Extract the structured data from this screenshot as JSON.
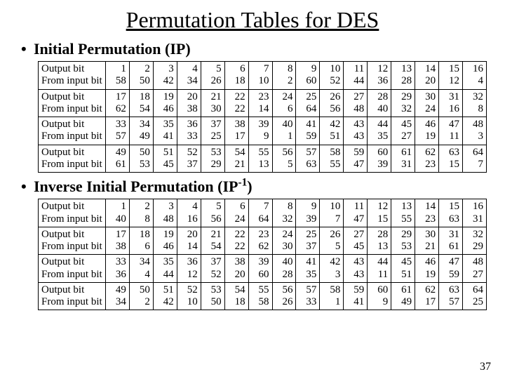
{
  "title": "Permutation Tables for DES",
  "page_number": "37",
  "sections": [
    {
      "heading_html": "Initial Permutation (IP)",
      "row_label_a": "Output bit",
      "row_label_b": "From input bit",
      "rows": [
        {
          "out": [
            1,
            2,
            3,
            4,
            5,
            6,
            7,
            8,
            9,
            10,
            11,
            12,
            13,
            14,
            15,
            16
          ],
          "from": [
            58,
            50,
            42,
            34,
            26,
            18,
            10,
            2,
            60,
            52,
            44,
            36,
            28,
            20,
            12,
            4
          ]
        },
        {
          "out": [
            17,
            18,
            19,
            20,
            21,
            22,
            23,
            24,
            25,
            26,
            27,
            28,
            29,
            30,
            31,
            32
          ],
          "from": [
            62,
            54,
            46,
            38,
            30,
            22,
            14,
            6,
            64,
            56,
            48,
            40,
            32,
            24,
            16,
            8
          ]
        },
        {
          "out": [
            33,
            34,
            35,
            36,
            37,
            38,
            39,
            40,
            41,
            42,
            43,
            44,
            45,
            46,
            47,
            48
          ],
          "from": [
            57,
            49,
            41,
            33,
            25,
            17,
            9,
            1,
            59,
            51,
            43,
            35,
            27,
            19,
            11,
            3
          ]
        },
        {
          "out": [
            49,
            50,
            51,
            52,
            53,
            54,
            55,
            56,
            57,
            58,
            59,
            60,
            61,
            62,
            63,
            64
          ],
          "from": [
            61,
            53,
            45,
            37,
            29,
            21,
            13,
            5,
            63,
            55,
            47,
            39,
            31,
            23,
            15,
            7
          ]
        }
      ]
    },
    {
      "heading_html": "Inverse Initial Permutation (IP<sup>-1</sup>)",
      "row_label_a": "Output bit",
      "row_label_b": "From input bit",
      "rows": [
        {
          "out": [
            1,
            2,
            3,
            4,
            5,
            6,
            7,
            8,
            9,
            10,
            11,
            12,
            13,
            14,
            15,
            16
          ],
          "from": [
            40,
            8,
            48,
            16,
            56,
            24,
            64,
            32,
            39,
            7,
            47,
            15,
            55,
            23,
            63,
            31
          ]
        },
        {
          "out": [
            17,
            18,
            19,
            20,
            21,
            22,
            23,
            24,
            25,
            26,
            27,
            28,
            29,
            30,
            31,
            32
          ],
          "from": [
            38,
            6,
            46,
            14,
            54,
            22,
            62,
            30,
            37,
            5,
            45,
            13,
            53,
            21,
            61,
            29
          ]
        },
        {
          "out": [
            33,
            34,
            35,
            36,
            37,
            38,
            39,
            40,
            41,
            42,
            43,
            44,
            45,
            46,
            47,
            48
          ],
          "from": [
            36,
            4,
            44,
            12,
            52,
            20,
            60,
            28,
            35,
            3,
            43,
            11,
            51,
            19,
            59,
            27
          ]
        },
        {
          "out": [
            49,
            50,
            51,
            52,
            53,
            54,
            55,
            56,
            57,
            58,
            59,
            60,
            61,
            62,
            63,
            64
          ],
          "from": [
            34,
            2,
            42,
            10,
            50,
            18,
            58,
            26,
            33,
            1,
            41,
            9,
            49,
            17,
            57,
            25
          ]
        }
      ]
    }
  ]
}
